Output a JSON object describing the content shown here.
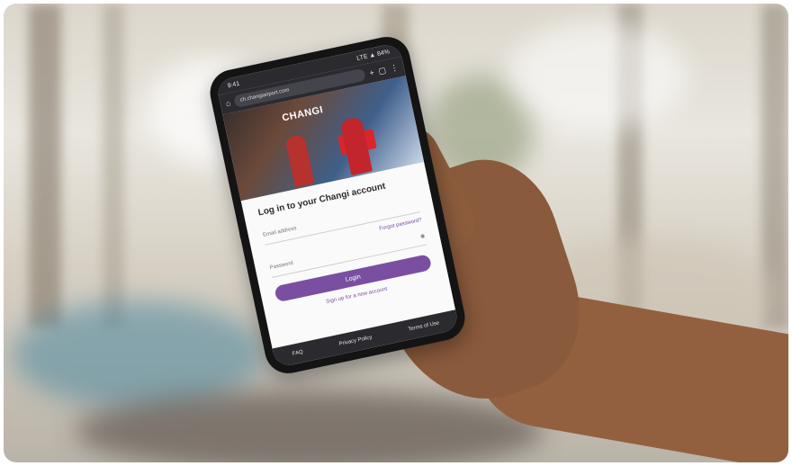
{
  "phone_screen": {
    "status_left": "9:41",
    "status_right": "LTE ▲ 84%",
    "url": "ch.changiairport.com",
    "hero_logo": "CHANGI",
    "form_title": "Log in to your Changi account",
    "email_label": "Email address",
    "forgot_link": "Forgot password?",
    "password_label": "Password",
    "login_button": "Login",
    "signup_link": "Sign up for a new account",
    "footer_links": [
      "FAQ",
      "Privacy Policy",
      "Terms of Use"
    ]
  },
  "colors": {
    "accent_purple": "#7a4fa2",
    "browser_dark": "#2a2a2f",
    "skin": "#8a5a3c"
  }
}
